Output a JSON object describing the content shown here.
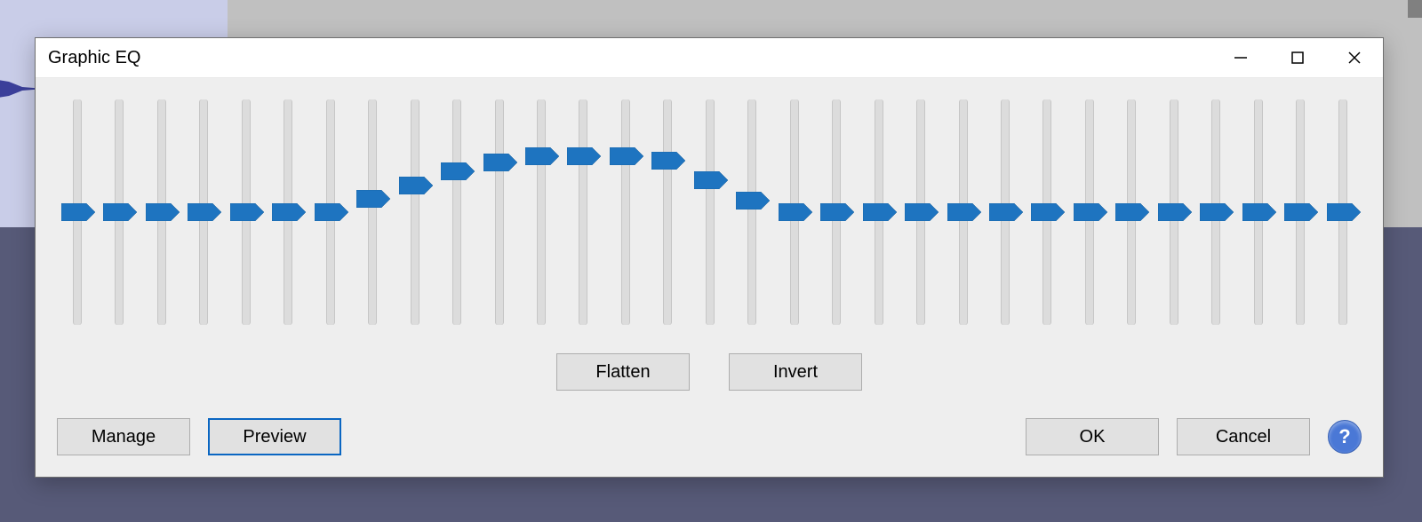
{
  "window": {
    "title": "Graphic EQ"
  },
  "buttons": {
    "flatten": "Flatten",
    "invert": "Invert",
    "manage": "Manage",
    "preview": "Preview",
    "ok": "OK",
    "cancel": "Cancel",
    "help": "?"
  },
  "accent_color": "#1e74c0",
  "eq": {
    "band_count": 31,
    "positions_percent_from_top": [
      50,
      50,
      50,
      50,
      50,
      50,
      50,
      44,
      38,
      32,
      28,
      25,
      25,
      25,
      27,
      36,
      45,
      50,
      50,
      50,
      50,
      50,
      50,
      50,
      50,
      50,
      50,
      50,
      50,
      50,
      50
    ]
  }
}
